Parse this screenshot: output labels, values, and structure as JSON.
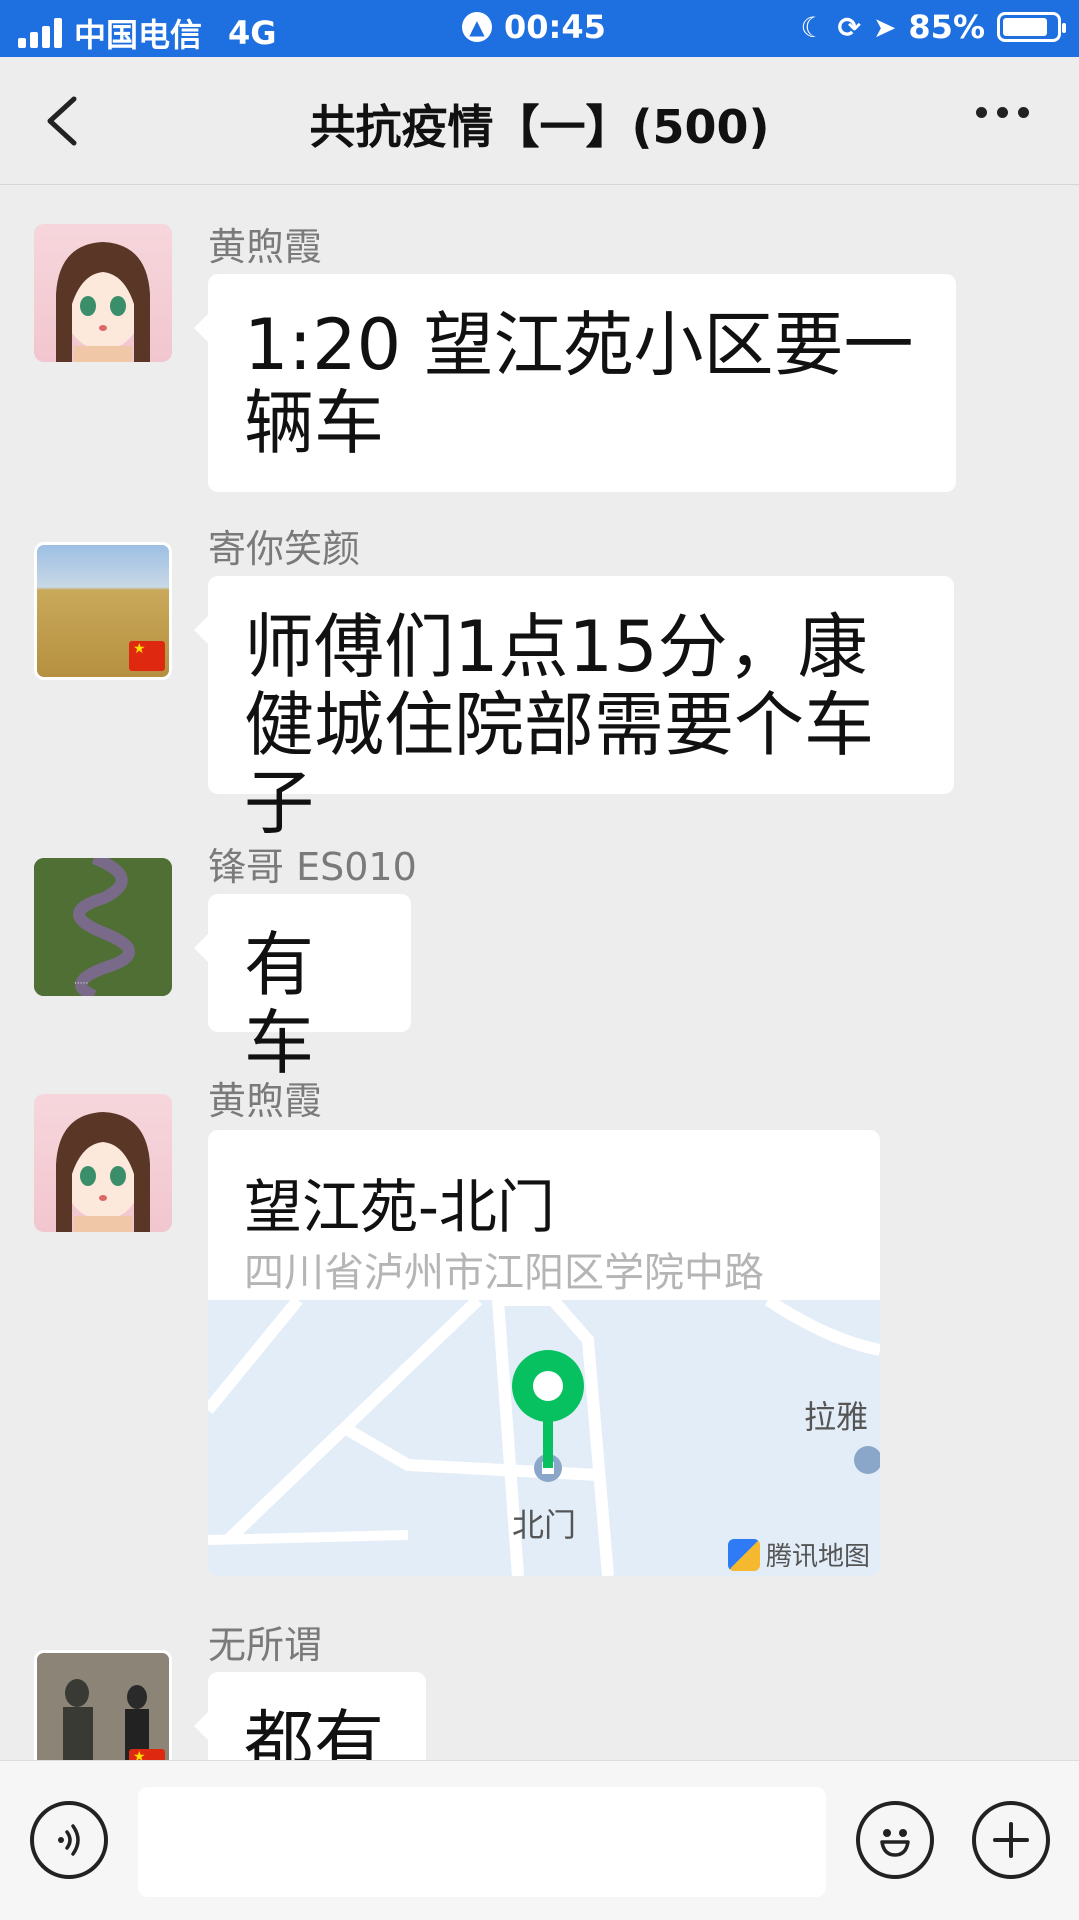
{
  "status_bar": {
    "carrier": "中国电信",
    "network": "4G",
    "time": "00:45",
    "battery": "85%",
    "battery_level": 0.85
  },
  "header": {
    "title": "共抗疫情【一】(500)",
    "back_icon": "chevron-left-icon",
    "more_icon": "more-dots-icon"
  },
  "messages": [
    {
      "sender": "黄煦霞",
      "text": "1:20 望江苑小区要一辆车"
    },
    {
      "sender": "寄你笑颜",
      "text": "师傅们1点15分，康健城住院部需要个车子"
    },
    {
      "sender": "锋哥 ES010",
      "text": "有车"
    },
    {
      "sender": "黄煦霞",
      "location": {
        "name": "望江苑-北门",
        "address": "四川省泸州市江阳区学院中路",
        "map_pin_label": "北门",
        "map_poi_label": "拉雅",
        "map_brand": "腾讯地图"
      }
    },
    {
      "sender": "无所谓",
      "text": "都有"
    }
  ],
  "input_bar": {
    "placeholder": "",
    "voice_icon": "voice-icon",
    "emoji_icon": "emoji-icon",
    "plus_icon": "plus-icon"
  },
  "colors": {
    "status_bar": "#1e6fe0",
    "background": "#ededed",
    "bubble": "#ffffff",
    "map_pin": "#07c160"
  }
}
